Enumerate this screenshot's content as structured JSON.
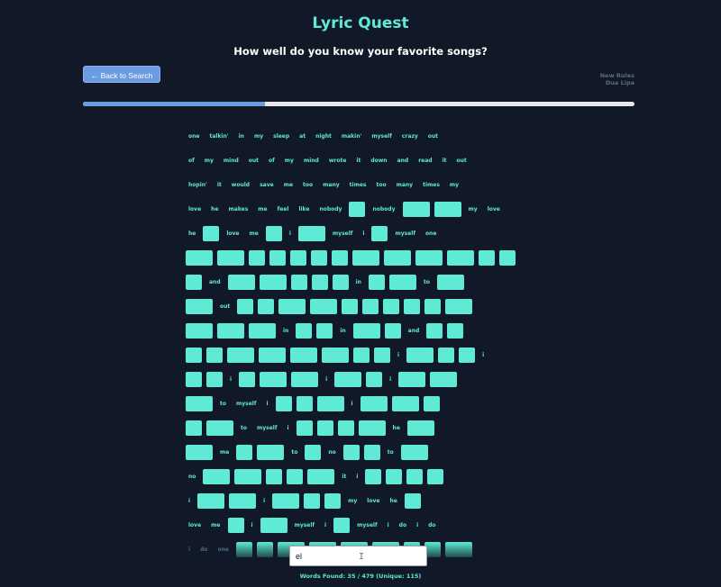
{
  "header": {
    "title": "Lyric Quest",
    "subtitle": "How well do you know your favorite songs?"
  },
  "back_button": {
    "label": "← Back to Search"
  },
  "song": {
    "title": "New Rules",
    "artist": "Dua Lipa"
  },
  "progress": {
    "fraction": 0.33
  },
  "guess": {
    "value": "el"
  },
  "status": {
    "text": "Words Found: 35 / 479 (Unique: 115)"
  },
  "lyrics": [
    [
      "one",
      "talkin'",
      "in",
      "my",
      "sleep",
      "at",
      "night",
      "makin'",
      "myself",
      "crazy",
      "out"
    ],
    [
      "of",
      "my",
      "mind",
      "out",
      "of",
      "my",
      "mind",
      "wrote",
      "it",
      "down",
      "and",
      "read",
      "it",
      "out"
    ],
    [
      "hopin'",
      "it",
      "would",
      "save",
      "me",
      "too",
      "many",
      "times",
      "too",
      "many",
      "times",
      "my"
    ],
    [
      "love",
      "he",
      "makes",
      "me",
      "feel",
      "like",
      "nobody",
      null,
      "nobody",
      null,
      null,
      "my",
      "love"
    ],
    [
      "he",
      null,
      "love",
      "me",
      null,
      "i",
      null,
      "myself",
      "i",
      null,
      "myself",
      "one"
    ],
    [
      null,
      null,
      null,
      null,
      null,
      null,
      null,
      null,
      null,
      null,
      null,
      null,
      null
    ],
    [
      null,
      "and",
      null,
      null,
      null,
      null,
      null,
      "in",
      null,
      null,
      "to",
      null
    ],
    [
      null,
      "out",
      null,
      null,
      null,
      null,
      null,
      null,
      null,
      null,
      null,
      null
    ],
    [
      null,
      null,
      null,
      "in",
      null,
      null,
      "in",
      null,
      null,
      "and",
      null,
      null
    ],
    [
      null,
      null,
      null,
      null,
      null,
      null,
      null,
      null,
      "i",
      null,
      null,
      null,
      "i"
    ],
    [
      null,
      null,
      "i",
      null,
      null,
      null,
      "i",
      null,
      null,
      "i",
      null,
      null
    ],
    [
      null,
      "to",
      "myself",
      "i",
      null,
      null,
      null,
      "i",
      null,
      null,
      null
    ],
    [
      null,
      null,
      "to",
      "myself",
      "i",
      null,
      null,
      null,
      null,
      "he",
      null
    ],
    [
      null,
      "me",
      null,
      null,
      "to",
      null,
      "no",
      null,
      null,
      "to",
      null
    ],
    [
      "no",
      null,
      null,
      null,
      null,
      null,
      "it",
      "i",
      null,
      null,
      null,
      null
    ],
    [
      "i",
      null,
      null,
      "i",
      null,
      null,
      null,
      "my",
      "love",
      "he",
      null
    ],
    [
      "love",
      "me",
      null,
      "i",
      null,
      "myself",
      "i",
      null,
      "myself",
      "i",
      "do",
      "i",
      "do"
    ],
    [
      "i",
      "do",
      "one",
      null,
      null,
      null,
      null,
      null,
      null,
      null,
      null,
      null
    ]
  ]
}
